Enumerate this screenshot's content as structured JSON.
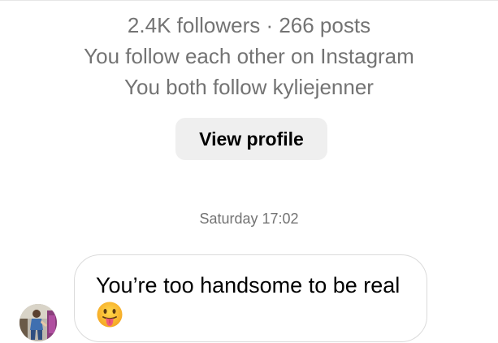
{
  "profile": {
    "stats": "2.4K followers · 266 posts",
    "mutual_follow": "You follow each other on Instagram",
    "mutual_friend": "You both follow kyliejenner",
    "view_profile_label": "View profile"
  },
  "thread": {
    "timestamp": "Saturday 17:02",
    "messages": [
      {
        "text": "You’re too handsome to be real",
        "emoji": "tongue-out-face-icon"
      }
    ]
  },
  "colors": {
    "secondary_text": "#737373",
    "button_bg": "#efefef",
    "bubble_border": "#dbdbdb"
  }
}
